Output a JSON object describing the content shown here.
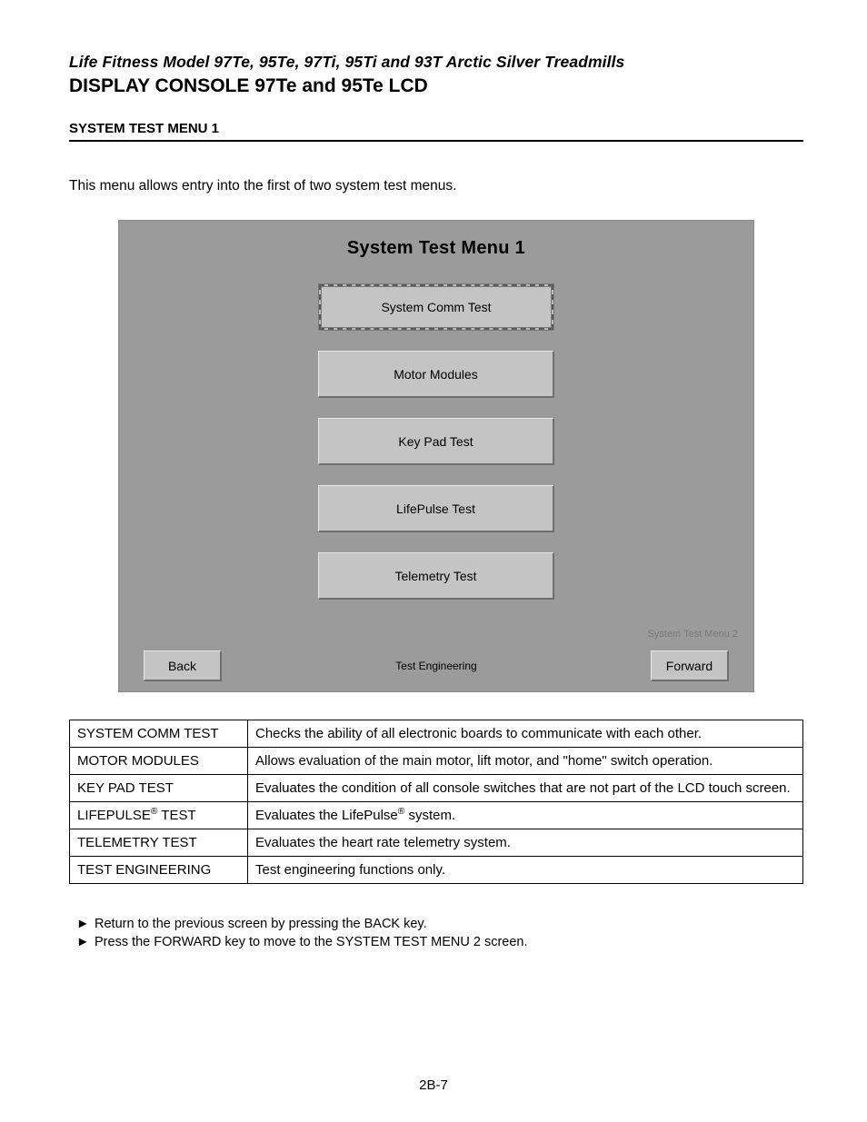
{
  "header": {
    "subtitle": "Life Fitness Model 97Te, 95Te, 97Ti, 95Ti and 93T Arctic Silver Treadmills",
    "title": "DISPLAY CONSOLE 97Te and 95Te LCD"
  },
  "section_title": "SYSTEM TEST MENU 1",
  "intro": "This menu allows entry into the first of two system test menus.",
  "lcd": {
    "title": "System Test Menu 1",
    "buttons": [
      "System Comm Test",
      "Motor Modules",
      "Key Pad Test",
      "LifePulse Test",
      "Telemetry Test"
    ],
    "hint": "System Test Menu 2",
    "footer_center": "Test Engineering",
    "back": "Back",
    "forward": "Forward"
  },
  "table": [
    {
      "label": "SYSTEM COMM TEST",
      "desc": "Checks the ability of all electronic boards to communicate with each other."
    },
    {
      "label": "MOTOR MODULES",
      "desc": "Allows evaluation of the main motor, lift motor, and \"home\" switch operation."
    },
    {
      "label": "KEY PAD TEST",
      "desc": "Evaluates the condition of all console switches that are not part of the LCD touch screen."
    },
    {
      "label_html": "LIFEPULSE<sup>®</sup> TEST",
      "desc_html": "Evaluates the LifePulse<sup>®</sup> system."
    },
    {
      "label": "TELEMETRY TEST",
      "desc": "Evaluates the heart rate telemetry system."
    },
    {
      "label": "TEST ENGINEERING",
      "desc": "Test engineering functions only."
    }
  ],
  "notes": [
    "Return to the previous screen by pressing the BACK key.",
    "Press the FORWARD key to move to the SYSTEM TEST MENU 2 screen."
  ],
  "page_number": "2B-7",
  "arrow": "►"
}
